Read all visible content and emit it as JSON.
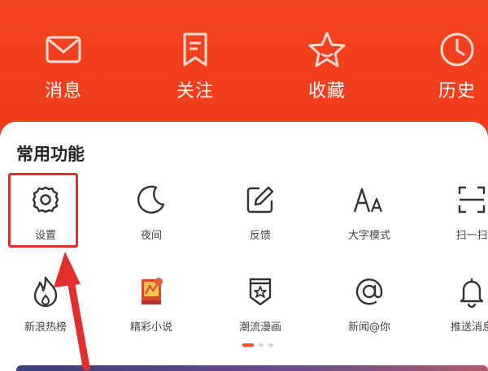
{
  "top_nav": [
    {
      "label": "消息",
      "icon": "mail-icon"
    },
    {
      "label": "关注",
      "icon": "bookmark-icon"
    },
    {
      "label": "收藏",
      "icon": "star-icon"
    },
    {
      "label": "历史",
      "icon": "clock-icon"
    }
  ],
  "common": {
    "title": "常用功能",
    "row1": [
      {
        "label": "设置",
        "icon": "gear-icon"
      },
      {
        "label": "夜间",
        "icon": "moon-icon"
      },
      {
        "label": "反馈",
        "icon": "edit-icon"
      },
      {
        "label": "大字模式",
        "icon": "font-size-icon"
      },
      {
        "label": "扫一扫",
        "icon": "scan-icon"
      }
    ],
    "row2": [
      {
        "label": "新浪热榜",
        "icon": "flame-icon"
      },
      {
        "label": "精彩小说",
        "icon": "novel-icon"
      },
      {
        "label": "潮流漫画",
        "icon": "badge-icon"
      },
      {
        "label": "新闻@你",
        "icon": "at-icon"
      },
      {
        "label": "推送消息",
        "icon": "bell-icon"
      }
    ]
  },
  "colors": {
    "brand_red": "#f2411f",
    "highlight": "#e0302b"
  }
}
